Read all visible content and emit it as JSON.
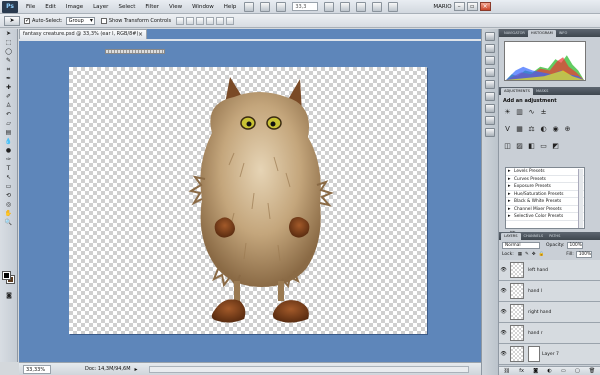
{
  "menubar": {
    "logo": "Ps",
    "items": [
      "File",
      "Edit",
      "Image",
      "Layer",
      "Select",
      "Filter",
      "View",
      "Window",
      "Help"
    ],
    "zoom": "33,3",
    "workspace": "MARIO"
  },
  "options": {
    "auto_select_label": "Auto-Select:",
    "auto_select_value": "Group",
    "transform_label": "Show Transform Controls"
  },
  "document": {
    "tab_title": "fantasy creature.psd @ 33,3% (ear l, RGB/8#)",
    "tab_close": "×"
  },
  "status": {
    "zoom": "33,33%",
    "doc_size": "Doc: 14,3M/94,6M",
    "arrow": "▸"
  },
  "histogram": {
    "tabs": [
      "NAVIGATOR",
      "HISTOGRAM",
      "INFO"
    ],
    "active_tab": "HISTOGRAM"
  },
  "adjustments": {
    "tabs": [
      "ADJUSTMENTS",
      "MASKS"
    ],
    "title": "Add an adjustment",
    "presets": [
      "Levels Presets",
      "Curves Presets",
      "Exposure Presets",
      "Hue/Saturation Presets",
      "Black & White Presets",
      "Channel Mixer Presets",
      "Selective Color Presets"
    ]
  },
  "layers": {
    "tabs": [
      "LAYERS",
      "CHANNELS",
      "PATHS"
    ],
    "blend_mode": "Normal",
    "opacity_label": "Opacity:",
    "opacity": "100%",
    "lock_label": "Lock:",
    "fill_label": "Fill:",
    "fill": "100%",
    "items": [
      {
        "name": "left hand"
      },
      {
        "name": "hand l"
      },
      {
        "name": "right hand"
      },
      {
        "name": "hand r"
      },
      {
        "name": "Layer 7"
      }
    ]
  },
  "colors": {
    "canvas_bg": "#5e86ba",
    "foreground": "#000000",
    "background": "#5a3a1e"
  }
}
